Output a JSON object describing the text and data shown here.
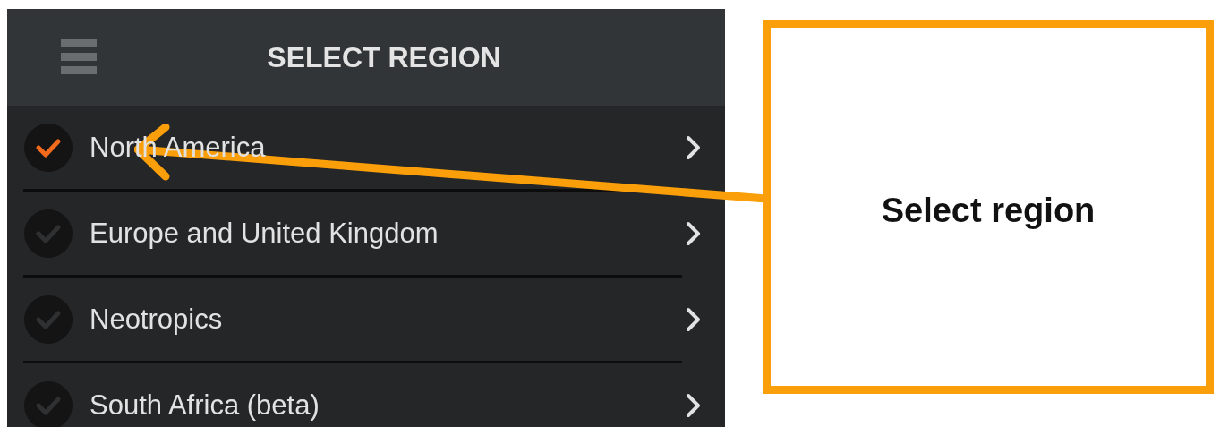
{
  "header": {
    "title": "SELECT REGION"
  },
  "regions": [
    {
      "label": "North America",
      "selected": true
    },
    {
      "label": "Europe and United Kingdom",
      "selected": false
    },
    {
      "label": "Neotropics",
      "selected": false
    },
    {
      "label": "South Africa (beta)",
      "selected": false
    }
  ],
  "callout": {
    "text": "Select region"
  }
}
